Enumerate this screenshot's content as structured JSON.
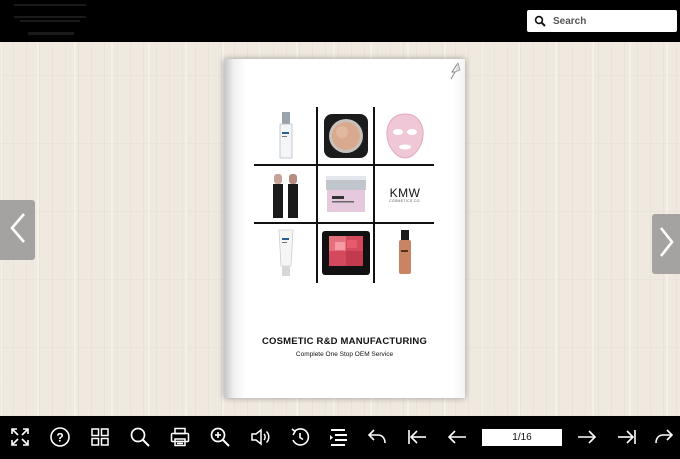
{
  "header": {
    "logo_icon": "company-logo",
    "search": {
      "placeholder": "Search",
      "value": "",
      "icon": "search-icon"
    }
  },
  "book": {
    "cover": {
      "title": "COSMETIC R&D MANUFACTURING",
      "subtitle": "Complete One Stop OEM Service",
      "brand_logo": "KMW",
      "products": [
        "serum-bottle",
        "compact-powder",
        "sheet-mask",
        "lipsticks",
        "cream-jar",
        "brand-logo",
        "sunscreen-tube",
        "blush-palette",
        "foundation-bottle"
      ]
    },
    "prev_icon": "chevron-left-icon",
    "next_icon": "chevron-right-icon"
  },
  "toolbar": {
    "page_indicator": "1/16",
    "buttons": [
      "fullscreen-icon",
      "help-icon",
      "thumbnails-icon",
      "search-icon",
      "print-icon",
      "zoom-in-icon",
      "sound-icon",
      "autoplay-icon",
      "table-of-contents-icon",
      "share-icon",
      "first-page-icon",
      "previous-page-icon",
      "next-page-icon",
      "last-page-icon",
      "forward-icon"
    ]
  },
  "colors": {
    "chrome": "#000000",
    "stage": "#efe9e0",
    "page": "#ffffff",
    "icon": "#ffffff"
  }
}
